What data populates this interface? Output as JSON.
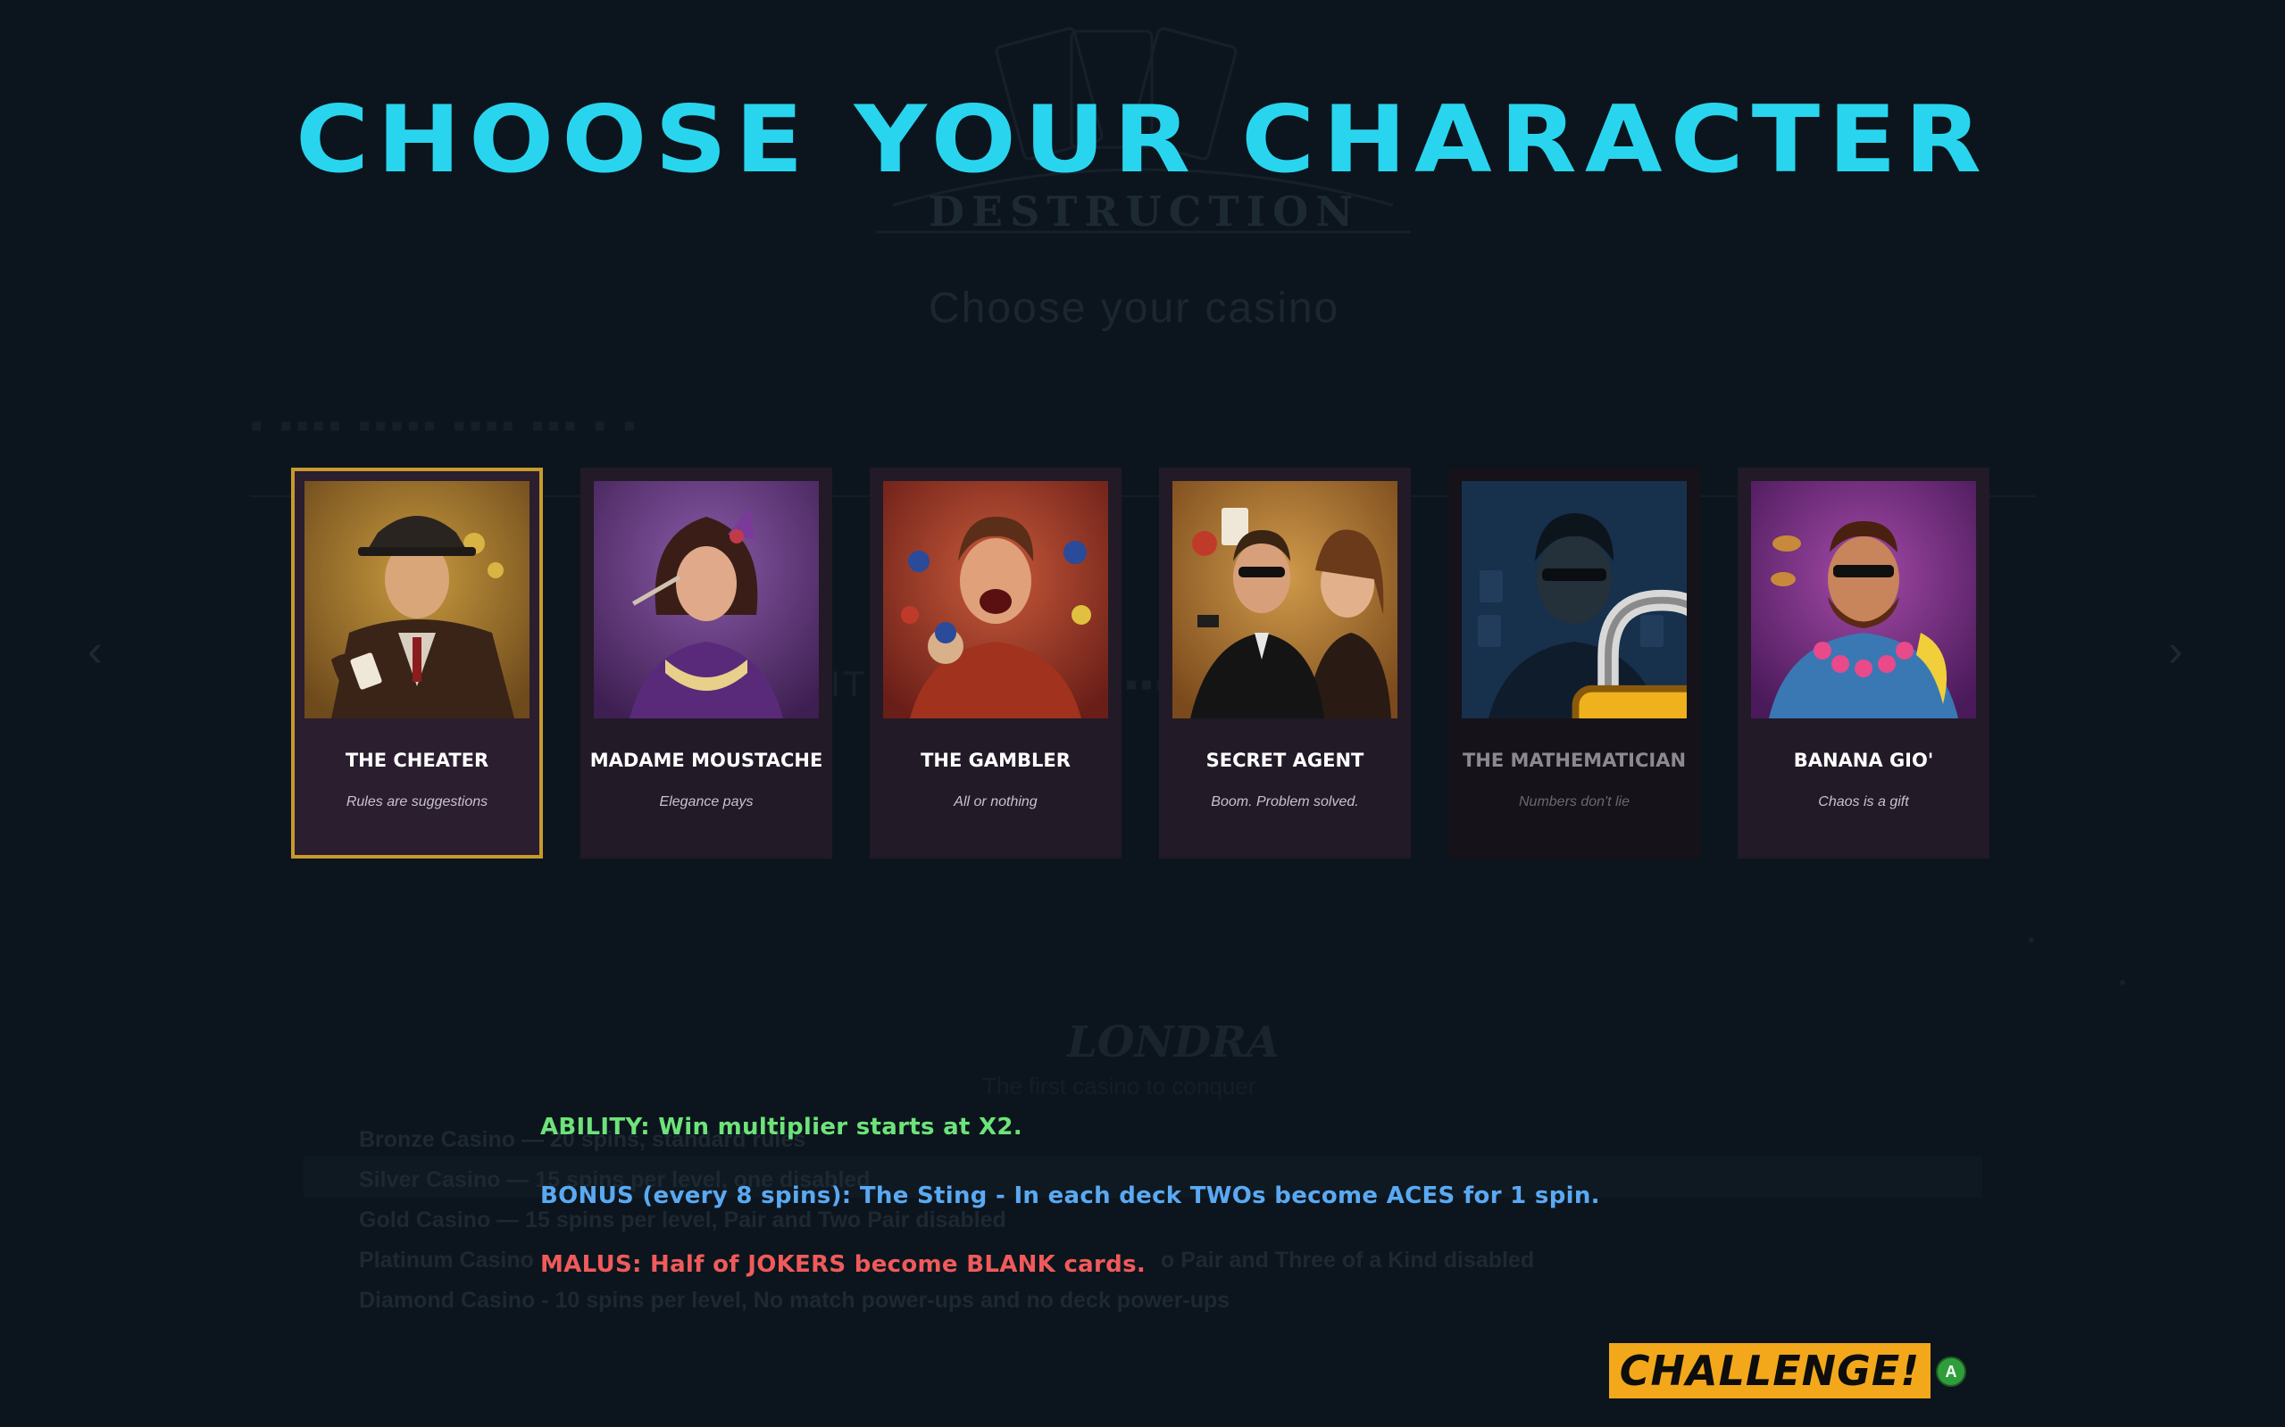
{
  "title": "CHOOSE YOUR CHARACTER",
  "background": {
    "logo_text": "DESTRUCTION",
    "subtitle": "Choose your casino",
    "casino_name": "LONDRA",
    "casino_subtitle": "The first casino to conquer",
    "tiers": [
      "Bronze Casino — 20 spins, standard rules",
      "Silver Casino — 15 spins per level, one disabled",
      "Gold Casino — 15 spins per level, Pair and Two Pair disabled",
      "Platinum Casino",
      "Diamond Casino - 10 spins per level, No match power-ups and no deck power-ups"
    ],
    "tier_right": "o Pair and Three of a Kind disabled"
  },
  "characters": [
    {
      "name": "THE CHEATER",
      "tagline": "Rules are suggestions",
      "state": "selected",
      "bg_color": "#b07a2a"
    },
    {
      "name": "MADAME MOUSTACHE",
      "tagline": "Elegance pays",
      "state": "available",
      "bg_color": "#6a3a8a"
    },
    {
      "name": "THE GAMBLER",
      "tagline": "All or nothing",
      "state": "available",
      "bg_color": "#a4352a"
    },
    {
      "name": "SECRET AGENT",
      "tagline": "Boom. Problem solved.",
      "state": "available",
      "bg_color": "#b8782e"
    },
    {
      "name": "THE MATHEMATICIAN",
      "tagline": "Numbers don't lie",
      "state": "locked",
      "bg_color": "#1e3a5c"
    },
    {
      "name": "BANANA GIO'",
      "tagline": "Chaos is a gift",
      "state": "available",
      "bg_color": "#7a2a8a"
    }
  ],
  "ability": {
    "text": "ABILITY: Win multiplier starts at X2.",
    "color": "#6de37a"
  },
  "bonus": {
    "text": "BONUS (every 8 spins): The Sting - In each deck TWOs become ACES for 1 spin.",
    "color": "#5aa9f2"
  },
  "malus": {
    "text": "MALUS: Half of JOKERS become BLANK cards.",
    "color": "#f05a5a"
  },
  "challenge_button": {
    "label": "CHALLENGE!",
    "hint": "A"
  },
  "colors": {
    "accent": "#29d5ee",
    "selected_border": "#c79a2b",
    "button": "#f3a81b"
  }
}
